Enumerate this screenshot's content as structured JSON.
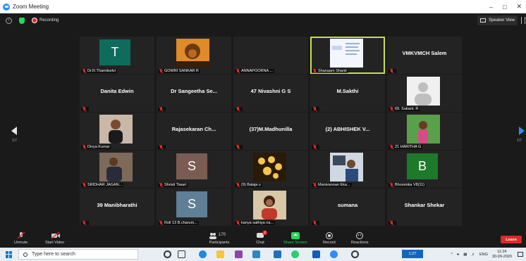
{
  "window": {
    "title": "Zoom Meeting",
    "recording_label": "Recording",
    "speaker_view_label": "Speaker View",
    "controls": [
      "–",
      "□",
      "✕"
    ]
  },
  "gallery": {
    "page_left": "1/7",
    "page_right": "1/7",
    "tiles": [
      {
        "name": "Dr.R.Thamilselvi",
        "letter": "T",
        "letter_bg": "#0f6b5c"
      },
      {
        "name": "GOWRI SANKAR R",
        "photo": "lion"
      },
      {
        "name": "ANNAPOORNA ..."
      },
      {
        "name": "Shanaam Shanti",
        "photo": "slide",
        "active": true
      },
      {
        "name": "",
        "big": "VMKVMCH Salem"
      },
      {
        "name": "",
        "big": "Danita Edwin"
      },
      {
        "name": "",
        "big": "Dr Sangeetha Se..."
      },
      {
        "name": "",
        "big": "47 Nivashni G S"
      },
      {
        "name": "",
        "big": "M.Sakthi"
      },
      {
        "name": "69. Sukant. R",
        "photo": "avatar"
      },
      {
        "name": "Divya Kumar",
        "photo": "woman"
      },
      {
        "name": "",
        "big": "Rajasekaran  Ch..."
      },
      {
        "name": "",
        "big": "(37)M.Madhunilla"
      },
      {
        "name": "",
        "big": "(2) ABHISHEK V..."
      },
      {
        "name": "21 HARITHA G",
        "photo": "girl"
      },
      {
        "name": "SRIDHAR JAGAN...",
        "photo": "man"
      },
      {
        "name": "Shristi Tiwari",
        "letter": "S",
        "letter_bg": "#7a5c52"
      },
      {
        "name": "(9) Balaje.v",
        "photo": "lights"
      },
      {
        "name": "Manivannan Eka...",
        "photo": "desk"
      },
      {
        "name": "Bhoomika V8(11)",
        "letter": "B",
        "letter_bg": "#1c7a2a"
      },
      {
        "name": "",
        "big": "39 Manibharathi"
      },
      {
        "name": "Roll 13 B.charum...",
        "letter": "S",
        "letter_bg": "#5f7f96"
      },
      {
        "name": "kanya sathiya na...",
        "photo": "lady"
      },
      {
        "name": "",
        "big": "sumana"
      },
      {
        "name": "",
        "big": "Shankar Shekar"
      }
    ]
  },
  "toolbar": {
    "unmute": "Unmute",
    "start_video": "Start Video",
    "participants_count": "170",
    "participants": "Participants",
    "chat": "Chat",
    "chat_badge": "2",
    "share_screen": "Share Screen",
    "record": "Record",
    "reactions": "Reactions",
    "leave": "Leave"
  },
  "taskbar": {
    "search_placeholder": "Type here to search",
    "active_app": "1:27",
    "lang": "ENG",
    "time": "11:24",
    "date": "30-09-2020"
  }
}
